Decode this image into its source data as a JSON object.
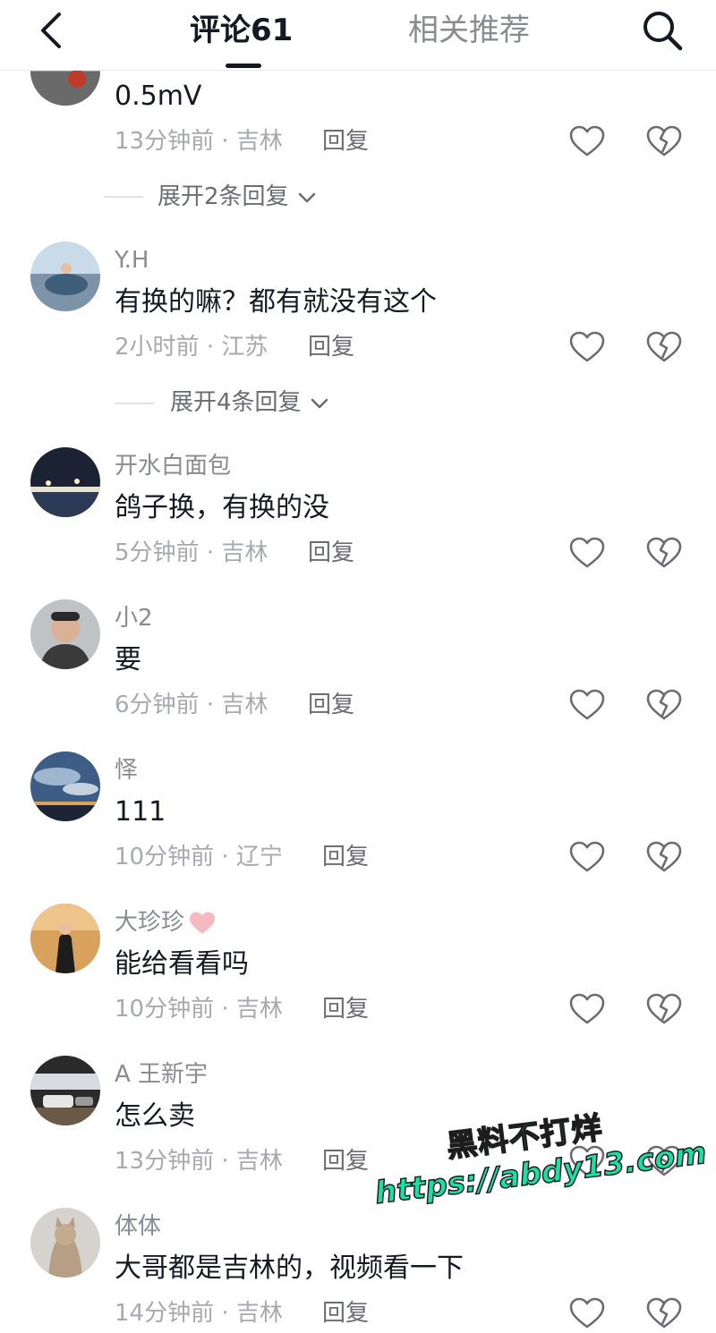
{
  "header": {
    "tab_comments": "评论61",
    "tab_related": "相关推荐"
  },
  "comments": [
    {
      "text": "0.5mV",
      "time": "13分钟前",
      "location": "吉林",
      "reply_label": "回复",
      "expand_label": "展开2条回复"
    },
    {
      "username": "Y.H",
      "text": "有换的嘛？都有就没有这个",
      "time": "2小时前",
      "location": "江苏",
      "reply_label": "回复",
      "expand_label": "展开4条回复"
    },
    {
      "username": "开水白面包",
      "text": "鸽子换，有换的没",
      "time": "5分钟前",
      "location": "吉林",
      "reply_label": "回复"
    },
    {
      "username": "小2",
      "text": "要",
      "time": "6分钟前",
      "location": "吉林",
      "reply_label": "回复"
    },
    {
      "username": "怿",
      "text": "111",
      "time": "10分钟前",
      "location": "辽宁",
      "reply_label": "回复"
    },
    {
      "username": "大珍珍",
      "text": "能给看看吗",
      "time": "10分钟前",
      "location": "吉林",
      "reply_label": "回复"
    },
    {
      "username": "A 王新宇",
      "text": "怎么卖",
      "time": "13分钟前",
      "location": "吉林",
      "reply_label": "回复"
    },
    {
      "username": "体体",
      "text": "大哥都是吉林的，视频看一下",
      "time": "14分钟前",
      "location": "吉林",
      "reply_label": "回复"
    }
  ],
  "separator": "·",
  "watermark": {
    "line1": "黑料不打烊",
    "line2": "https://abdy13.com"
  },
  "colors": {
    "watermark_fill": "#18e2a3",
    "text_primary": "#161823",
    "text_secondary": "#8a8b91"
  }
}
